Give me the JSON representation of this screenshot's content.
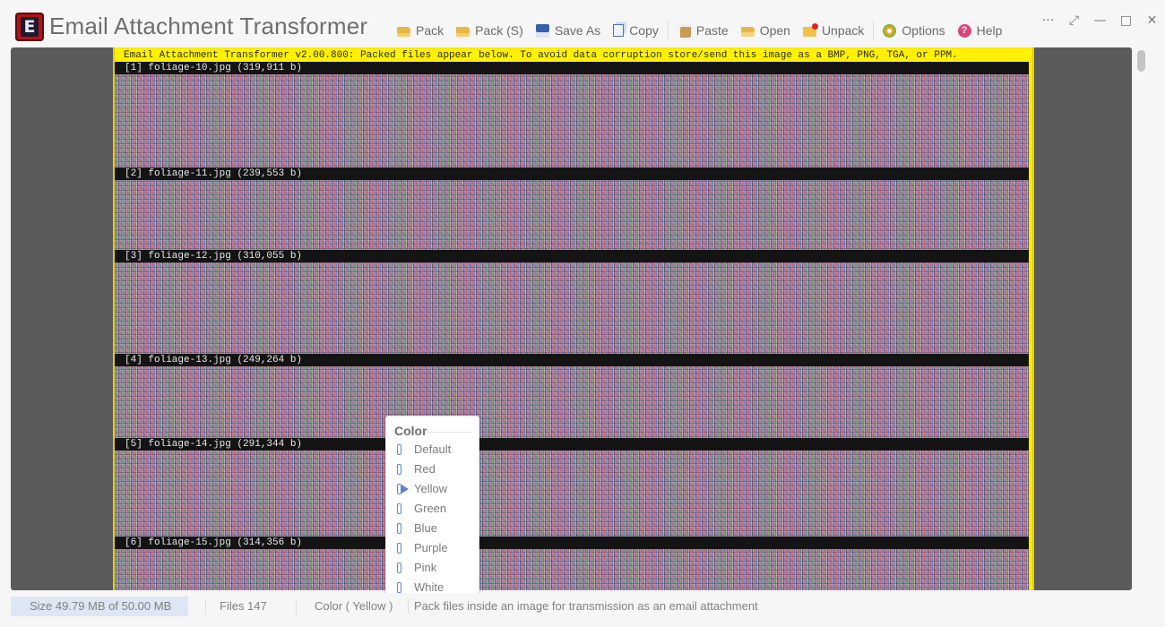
{
  "app": {
    "title": "Email Attachment Transformer",
    "logo_letter": "E"
  },
  "toolbar": {
    "pack": "Pack",
    "pack_s": "Pack (S)",
    "save_as": "Save As",
    "copy": "Copy",
    "paste": "Paste",
    "open": "Open",
    "unpack": "Unpack",
    "options": "Options",
    "help": "Help",
    "help_glyph": "?"
  },
  "window_controls": {
    "more": "···",
    "expand": "⤢",
    "minimize": "—",
    "maximize": "□",
    "close": "✕"
  },
  "image": {
    "header": "Email Attachment Transformer v2.00.800: Packed files appear below. To avoid data corruption store/send this image as a BMP, PNG, TGA, or PPM.",
    "files": [
      {
        "label": "[1] foliage-10.jpg (319,911 b)"
      },
      {
        "label": "[2] foliage-11.jpg (239,553 b)"
      },
      {
        "label": "[3] foliage-12.jpg (310,055 b)"
      },
      {
        "label": "[4] foliage-13.jpg (249,264 b)"
      },
      {
        "label": "[5] foliage-14.jpg (291,344 b)"
      },
      {
        "label": "[6] foliage-15.jpg (314,356 b)"
      }
    ]
  },
  "color_menu": {
    "title": "Color",
    "items": [
      {
        "label": "Default",
        "selected": false
      },
      {
        "label": "Red",
        "selected": false
      },
      {
        "label": "Yellow",
        "selected": true
      },
      {
        "label": "Green",
        "selected": false
      },
      {
        "label": "Blue",
        "selected": false
      },
      {
        "label": "Purple",
        "selected": false
      },
      {
        "label": "Pink",
        "selected": false
      },
      {
        "label": "White",
        "selected": false
      }
    ]
  },
  "status": {
    "size": "Size 49.79 MB of 50.00 MB",
    "files": "Files 147",
    "color": "Color ( Yellow )",
    "hint": "Pack files inside an image for transmission as an email attachment"
  },
  "colors": {
    "accent": "#5a86c7",
    "header_band": "#fff100",
    "label_band": "#141414",
    "canvas_bg": "#5b5b5b"
  }
}
